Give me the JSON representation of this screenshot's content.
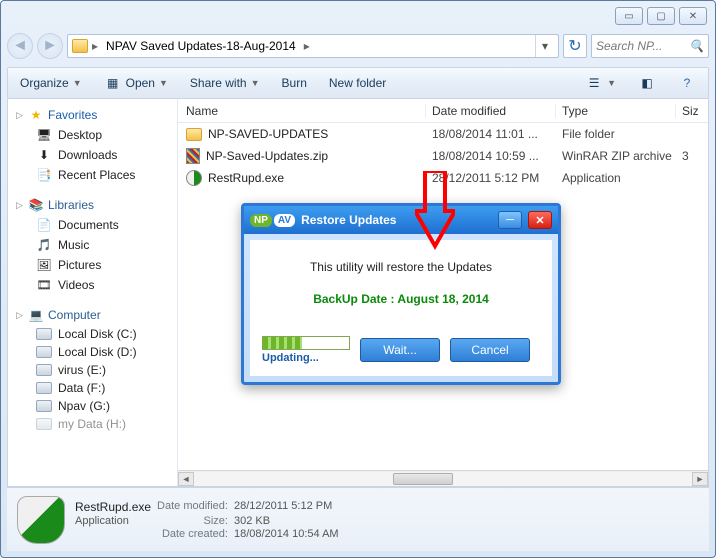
{
  "titlebar": {
    "min": "▭",
    "max": "▢",
    "close": "✕"
  },
  "breadcrumb": {
    "segment1": "NPAV Saved Updates-18-Aug-2014"
  },
  "search": {
    "placeholder": "Search NP..."
  },
  "toolbar": {
    "organize": "Organize",
    "open": "Open",
    "share": "Share with",
    "burn": "Burn",
    "newfolder": "New folder"
  },
  "sidebar": {
    "favorites": "Favorites",
    "desktop": "Desktop",
    "downloads": "Downloads",
    "recent": "Recent Places",
    "libraries": "Libraries",
    "documents": "Documents",
    "music": "Music",
    "pictures": "Pictures",
    "videos": "Videos",
    "computer": "Computer",
    "driveC": "Local Disk (C:)",
    "driveD": "Local Disk (D:)",
    "driveE": "virus (E:)",
    "driveF": "Data (F:)",
    "driveG": "Npav (G:)",
    "driveH": "my Data (H:)"
  },
  "headers": {
    "name": "Name",
    "date": "Date modified",
    "type": "Type",
    "size": "Siz"
  },
  "rows": [
    {
      "name": "NP-SAVED-UPDATES",
      "date": "18/08/2014 11:01 ...",
      "type": "File folder",
      "size": "",
      "icon": "folder"
    },
    {
      "name": "NP-Saved-Updates.zip",
      "date": "18/08/2014 10:59 ...",
      "type": "WinRAR ZIP archive",
      "size": "3",
      "icon": "zip"
    },
    {
      "name": "RestRupd.exe",
      "date": "28/12/2011 5:12 PM",
      "type": "Application",
      "size": "",
      "icon": "exe"
    }
  ],
  "details": {
    "name": "RestRupd.exe",
    "type": "Application",
    "lbl_modified": "Date modified:",
    "val_modified": "28/12/2011 5:12 PM",
    "lbl_size": "Size:",
    "val_size": "302 KB",
    "lbl_created": "Date created:",
    "val_created": "18/08/2014 10:54 AM"
  },
  "dialog": {
    "logo_np": "NP",
    "logo_av": "AV",
    "title": "Restore Updates",
    "message": "This utility will restore the Updates",
    "backup": "BackUp Date : August 18, 2014",
    "updating": "Updating...",
    "wait": "Wait...",
    "cancel": "Cancel"
  }
}
